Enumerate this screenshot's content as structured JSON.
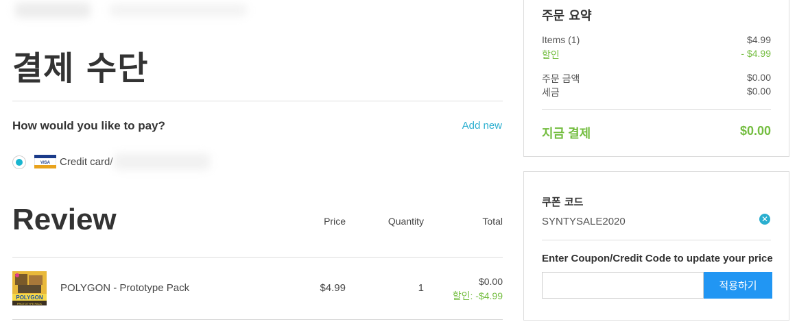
{
  "payment": {
    "title": "결제 수단",
    "question": "How would you like to pay?",
    "add_new_label": "Add new",
    "method_label": "Credit card/"
  },
  "review": {
    "title": "Review",
    "columns": {
      "price": "Price",
      "quantity": "Quantity",
      "total": "Total"
    },
    "items": [
      {
        "name": "POLYGON - Prototype Pack",
        "price": "$4.99",
        "quantity": "1",
        "total": "$0.00",
        "discount": "할인: -$4.99"
      }
    ]
  },
  "summary": {
    "title": "주문 요약",
    "items_label": "Items (1)",
    "items_value": "$4.99",
    "discount_label": "할인",
    "discount_value": "- $4.99",
    "order_amount_label": "주문 금액",
    "order_amount_value": "$0.00",
    "tax_label": "세금",
    "tax_value": "$0.00",
    "pay_now_label": "지금 결제",
    "pay_now_value": "$0.00"
  },
  "coupon": {
    "title": "쿠폰 코드",
    "applied_code": "SYNTYSALE2020",
    "prompt": "Enter Coupon/Credit Code to update your price",
    "input_value": "",
    "apply_label": "적용하기"
  },
  "colors": {
    "accent": "#29aecf",
    "green": "#73bd3f",
    "button": "#2196f3"
  }
}
